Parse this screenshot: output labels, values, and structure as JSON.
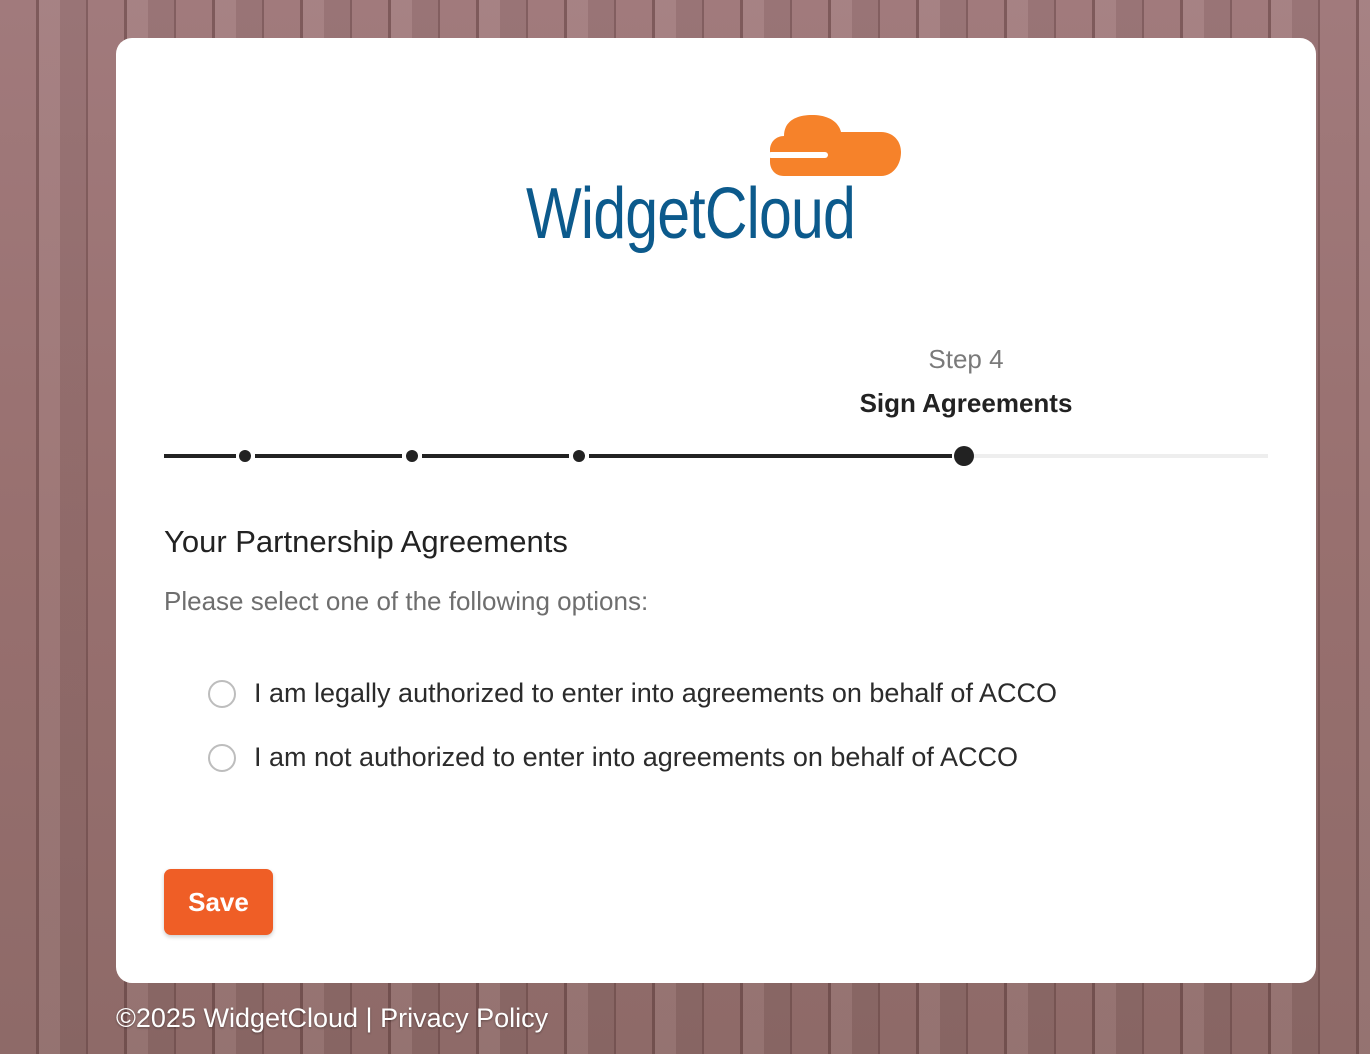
{
  "brand": {
    "name": "WidgetCloud",
    "logo_icon": "cloud-icon",
    "colors": {
      "text": "#0c5a8c",
      "cloud": "#f6822a"
    }
  },
  "stepper": {
    "step_label": "Step 4",
    "step_title": "Sign Agreements",
    "total_steps": 4,
    "current_step": 4,
    "colors": {
      "done": "#222222",
      "remaining": "#eeeeee"
    }
  },
  "section": {
    "title": "Your Partnership Agreements",
    "instructions": "Please select one of the following options:"
  },
  "options": [
    {
      "label": "I am legally authorized to enter into agreements on behalf of ACCO",
      "selected": false
    },
    {
      "label": "I am not authorized to enter into agreements on behalf of ACCO",
      "selected": false
    }
  ],
  "actions": {
    "save_label": "Save",
    "accent": "#ef5e26"
  },
  "footer": {
    "copyright": "©2025 WidgetCloud |",
    "privacy_label": "Privacy Policy"
  }
}
